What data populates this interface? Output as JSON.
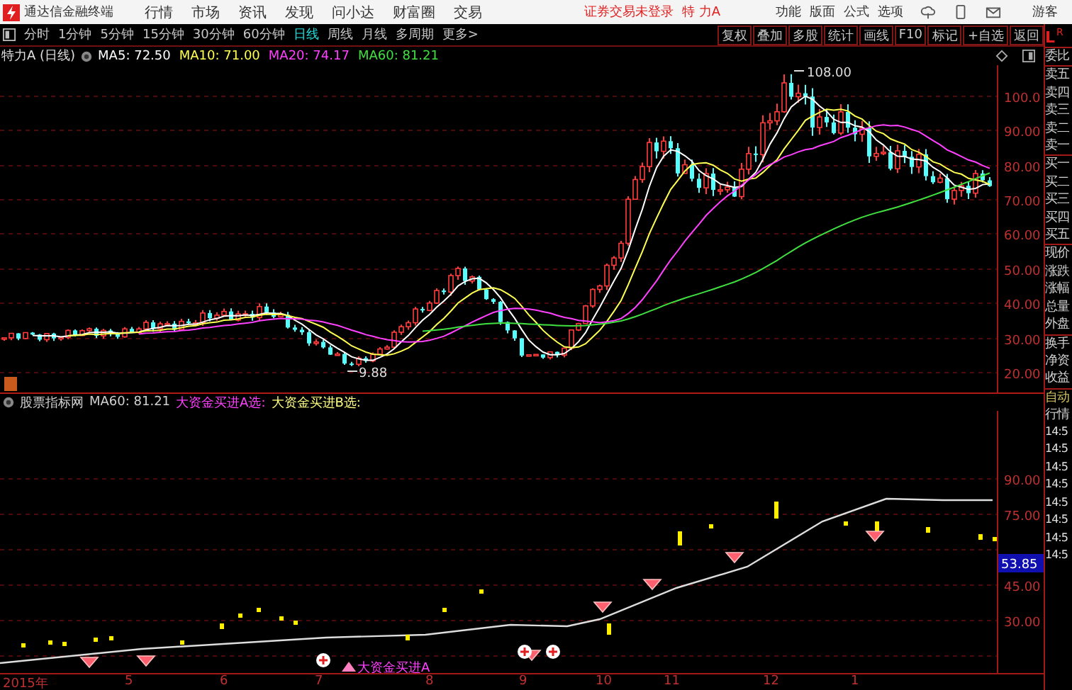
{
  "app": {
    "title": "通达信金融终端"
  },
  "menu": [
    "行情",
    "市场",
    "资讯",
    "发现",
    "问小达",
    "财富圈",
    "交易"
  ],
  "login_status": "证券交易未登录",
  "stock_name": "特 力A",
  "top_actions": [
    "功能",
    "版面",
    "公式",
    "选项"
  ],
  "user": "游客",
  "periods": [
    {
      "label": "分时",
      "selected": false
    },
    {
      "label": "1分钟",
      "selected": false
    },
    {
      "label": "5分钟",
      "selected": false
    },
    {
      "label": "15分钟",
      "selected": false
    },
    {
      "label": "30分钟",
      "selected": false
    },
    {
      "label": "60分钟",
      "selected": false
    },
    {
      "label": "日线",
      "selected": true
    },
    {
      "label": "周线",
      "selected": false
    },
    {
      "label": "月线",
      "selected": false
    },
    {
      "label": "多周期",
      "selected": false
    },
    {
      "label": "更多>",
      "selected": false
    }
  ],
  "tools": [
    "复权",
    "叠加",
    "多股",
    "统计",
    "画线",
    "F10",
    "标记",
    "+自选",
    "返回"
  ],
  "chart": {
    "title": "特力A (日线)",
    "ma": [
      {
        "label": "MA5: 72.50",
        "color": "#ffffff"
      },
      {
        "label": "MA10: 71.00",
        "color": "#ffff50"
      },
      {
        "label": "MA20: 74.17",
        "color": "#ff40ff"
      },
      {
        "label": "MA60: 81.21",
        "color": "#40e040"
      }
    ],
    "y_labels": [
      "100.0",
      "90.00",
      "80.00",
      "70.00",
      "60.00",
      "50.00",
      "40.00",
      "30.00",
      "20.00"
    ],
    "high_label": "108.00",
    "low_label": "9.88"
  },
  "indicator": {
    "name": "股票指标网",
    "ma": "MA60: 81.21",
    "signals": [
      {
        "label": "大资金买进A选:",
        "color": "#ff40ff"
      },
      {
        "label": "大资金买进B选:",
        "color": "#ffff80"
      }
    ],
    "y_labels": [
      "90.00",
      "75.00",
      "45.00",
      "30.00"
    ],
    "current_value": "53.85",
    "annotation": "大资金买进A"
  },
  "x_axis": [
    "2015年",
    "5",
    "6",
    "7",
    "8",
    "9",
    "10",
    "11",
    "12",
    "1"
  ],
  "sidebar": {
    "header": [
      "L",
      "R"
    ],
    "quote_groups": [
      [
        "委比"
      ],
      [
        "卖五",
        "卖四",
        "卖三",
        "卖二",
        "卖一"
      ],
      [
        "买一",
        "买二",
        "买三",
        "买四",
        "买五"
      ],
      [
        "现价",
        "涨跌",
        "涨幅",
        "总量",
        "外盘"
      ],
      [
        "换手",
        "净资",
        "收益"
      ]
    ],
    "tabs": [
      "自动",
      "行情"
    ],
    "times": [
      "14:5",
      "14:5",
      "14:5",
      "14:5",
      "14:5",
      "14:5",
      "14:5",
      "14:5"
    ]
  }
}
